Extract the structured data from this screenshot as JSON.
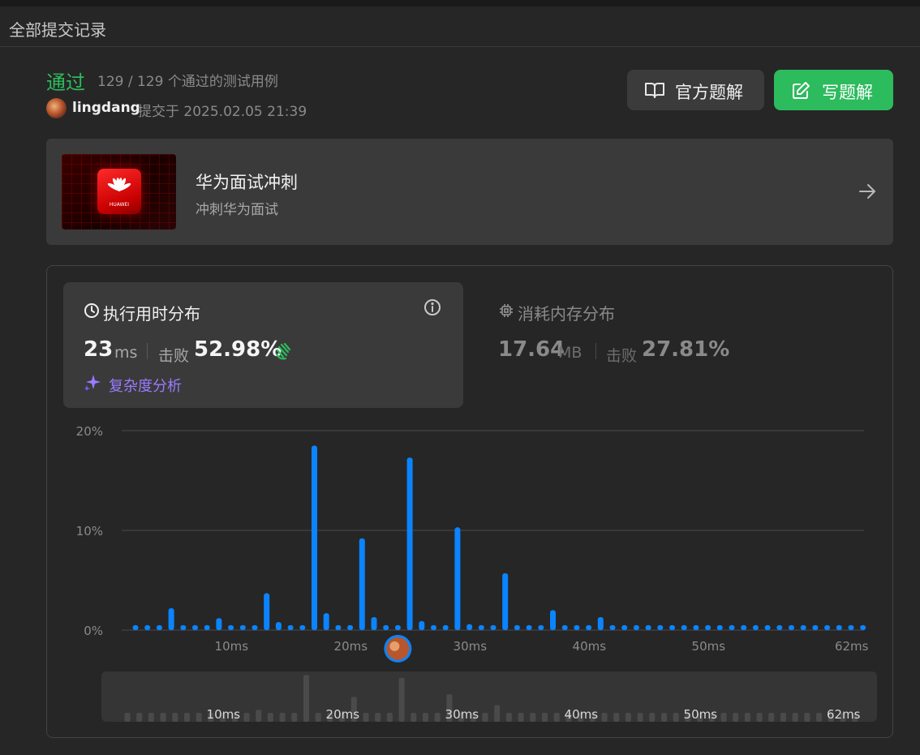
{
  "header": {
    "title": "全部提交记录"
  },
  "submission": {
    "status": "通过",
    "cases": "129 / 129 个通过的测试用例",
    "user": "lingdang",
    "submitted": "提交于 2025.02.05 21:39"
  },
  "buttons": {
    "official_solution": "官方题解",
    "write_solution": "写题解"
  },
  "promo": {
    "title": "华为面试冲刺",
    "subtitle": "冲刺华为面试",
    "logo_text": "HUAWEI"
  },
  "runtime": {
    "title": "执行用时分布",
    "value": "23",
    "unit": "ms",
    "beat_label": "击败",
    "beat_value": "52.98%",
    "complexity_label": "复杂度分析"
  },
  "memory": {
    "title": "消耗内存分布",
    "value": "17.64",
    "unit": "MB",
    "beat_label": "击败",
    "beat_value": "27.81%"
  },
  "colors": {
    "accent_green": "#2cbb5d",
    "bar_blue": "#0a84ff",
    "mini_bar": "#4a4a4a",
    "purple": "#9b7bff"
  },
  "chart_data": {
    "type": "bar",
    "xlabel": "",
    "ylabel": "",
    "ylim": [
      0,
      20
    ],
    "y_ticks": [
      "0%",
      "10%",
      "20%"
    ],
    "y_tick_values": [
      0,
      10,
      20
    ],
    "x_ticks": [
      "10ms",
      "20ms",
      "30ms",
      "40ms",
      "50ms",
      "62ms"
    ],
    "x_tick_values": [
      10,
      20,
      30,
      40,
      50,
      62
    ],
    "x": [
      1,
      2,
      3,
      4,
      5,
      6,
      7,
      8,
      9,
      10,
      11,
      12,
      13,
      14,
      15,
      16,
      17,
      18,
      19,
      20,
      21,
      22,
      23,
      24,
      25,
      26,
      27,
      28,
      29,
      30,
      31,
      32,
      33,
      34,
      35,
      36,
      37,
      38,
      39,
      40,
      41,
      42,
      43,
      44,
      45,
      46,
      47,
      48,
      49,
      50,
      51,
      52,
      53,
      54,
      55,
      56,
      57,
      58,
      59,
      60,
      61,
      62
    ],
    "values": [
      0.5,
      0.5,
      0.5,
      2.2,
      0.5,
      0.5,
      0.5,
      1.2,
      0.5,
      0.5,
      0.5,
      3.7,
      0.8,
      0.5,
      0.5,
      18.5,
      1.7,
      0.5,
      0.5,
      9.2,
      1.3,
      0.5,
      0.5,
      17.3,
      0.9,
      0.5,
      0.5,
      10.3,
      0.6,
      0.5,
      0.5,
      5.7,
      0.5,
      0.5,
      0.5,
      2.0,
      0.5,
      0.5,
      0.5,
      1.3,
      0.5,
      0.5,
      0.5,
      0.5,
      0.5,
      0.5,
      0.5,
      0.5,
      0.5,
      0.5,
      0.5,
      0.5,
      0.5,
      0.5,
      0.5,
      0.5,
      0.5,
      0.5,
      0.5,
      0.5,
      0.5,
      0.5
    ],
    "highlight_x": 23,
    "grid": true,
    "mini_x_ticks": [
      "10ms",
      "20ms",
      "30ms",
      "40ms",
      "50ms",
      "62ms"
    ]
  }
}
